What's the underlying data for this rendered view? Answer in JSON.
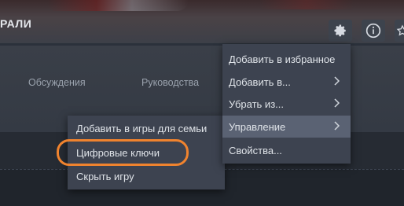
{
  "header": {
    "title": "РАЛИ"
  },
  "icons": {
    "settings": "gear-icon",
    "info": "info-icon",
    "favorite": "star-icon"
  },
  "subnav": {
    "discussions": "Обсуждения",
    "guides": "Руководства"
  },
  "main_menu": {
    "items": [
      {
        "label": "Добавить в избранное",
        "has_submenu": false
      },
      {
        "label": "Добавить в...",
        "has_submenu": true
      },
      {
        "label": "Убрать из...",
        "has_submenu": true
      },
      {
        "label": "Управление",
        "has_submenu": true,
        "active": true
      },
      {
        "label": "Свойства...",
        "has_submenu": false
      }
    ]
  },
  "submenu": {
    "items": [
      {
        "label": "Добавить в игры для семьи"
      },
      {
        "label": "Цифровые ключи"
      },
      {
        "label": "Скрыть игру"
      }
    ]
  },
  "colors": {
    "accent_highlight": "#f0832e",
    "menu_bg": "#3d4350",
    "menu_active": "#5a6273"
  }
}
